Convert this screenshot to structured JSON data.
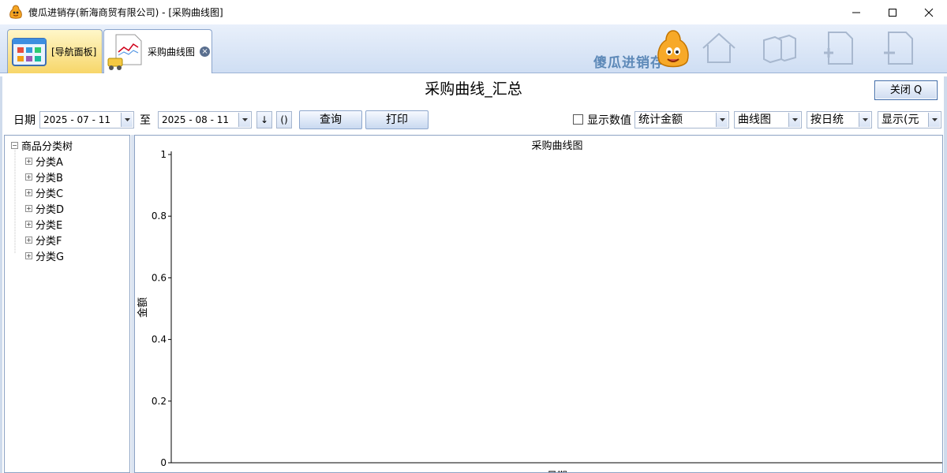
{
  "window": {
    "title": "傻瓜进销存(新海商贸有限公司) - [采购曲线图]"
  },
  "tabs": [
    {
      "label": "[导航面板]",
      "icon": "dashboard-icon"
    },
    {
      "label": "采购曲线图",
      "icon": "chart-document-icon"
    }
  ],
  "brand": {
    "name": "傻瓜进销存"
  },
  "panel": {
    "title": "采购曲线_汇总",
    "close_label": "关闭 Q"
  },
  "toolbar": {
    "date_label": "日期",
    "start_date": "2025 - 07 - 11",
    "to_label": "至",
    "end_date": "2025 - 08 - 11",
    "down_btn": "↓",
    "paren_btn": "()",
    "query_label": "查询",
    "print_label": "打印",
    "show_values_label": "显示数值",
    "stat_select": "统计金额",
    "chart_type_select": "曲线图",
    "period_select": "按日统",
    "display_select": "显示(元"
  },
  "tree": {
    "root": "商品分类树",
    "items": [
      "分类A",
      "分类B",
      "分类C",
      "分类D",
      "分类E",
      "分类F",
      "分类G"
    ]
  },
  "chart_data": {
    "type": "line",
    "title": "采购曲线图",
    "xlabel": "日期",
    "ylabel": "金额",
    "ylim": [
      0,
      1
    ],
    "yticks": [
      "0",
      "0.2",
      "0.4",
      "0.6",
      "0.8",
      "1"
    ],
    "series": []
  }
}
